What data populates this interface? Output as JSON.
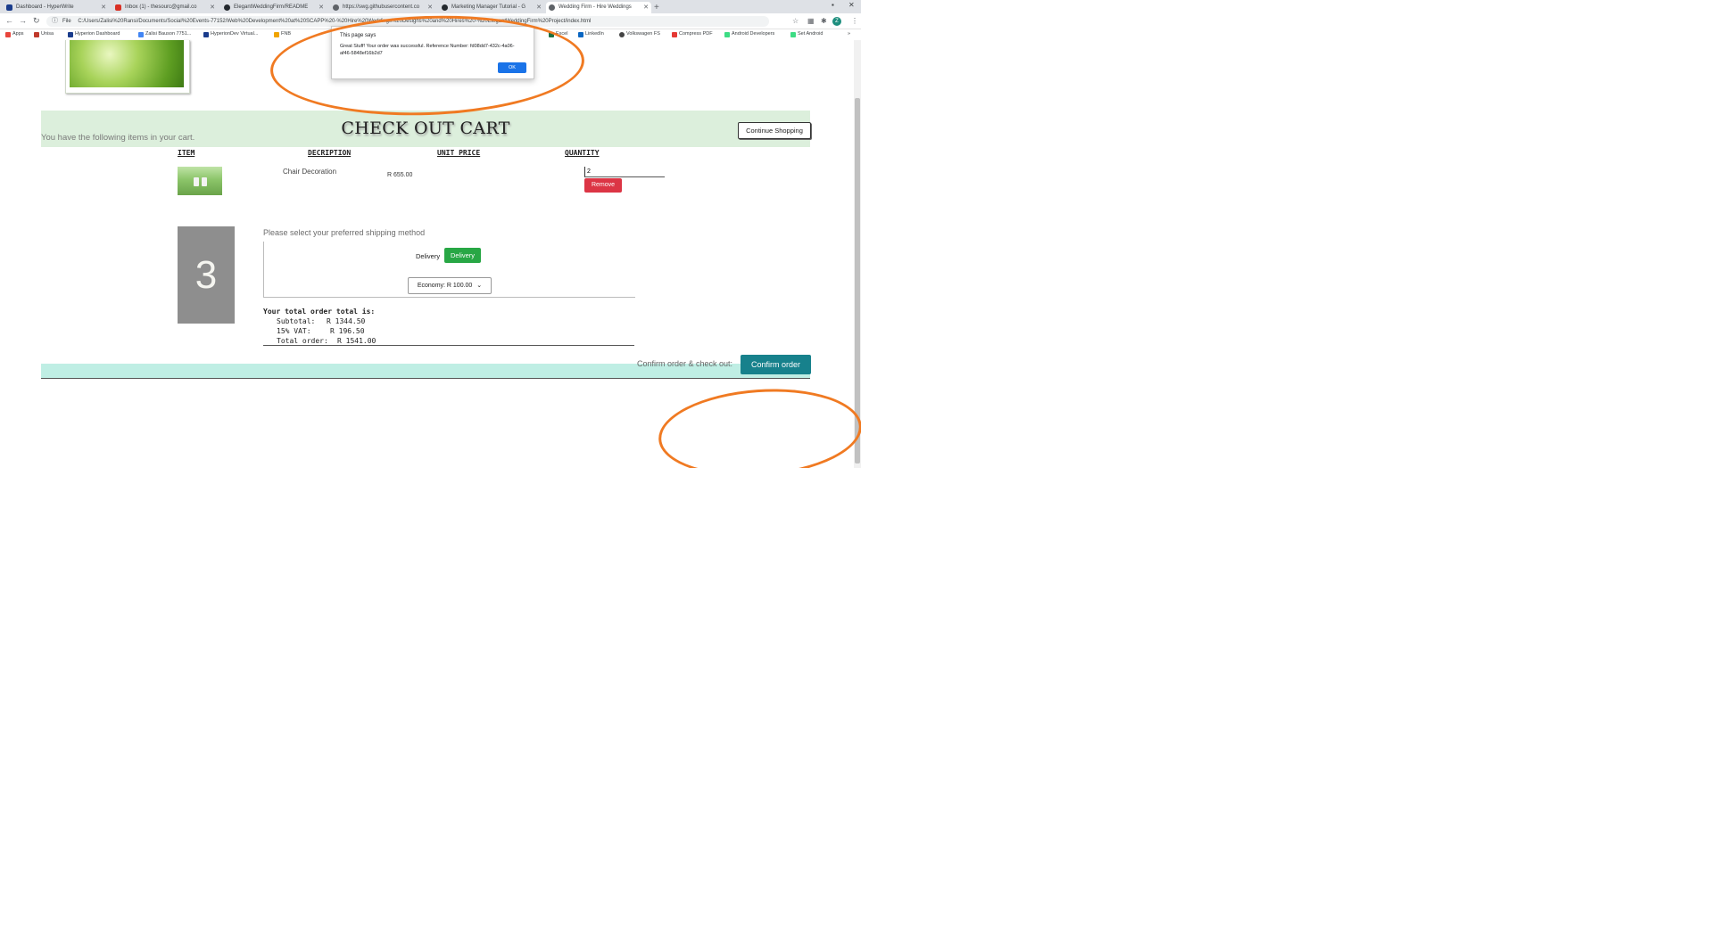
{
  "tabs": [
    {
      "title": "Dashboard - HyperWrite"
    },
    {
      "title": "Inbox (1) - thesourc@gmail.co"
    },
    {
      "title": "ElegantWeddingFirm/README"
    },
    {
      "title": "https://swg.githubusercontent.co"
    },
    {
      "title": "Marketing Manager Tutorial - G"
    },
    {
      "title": "Wedding Firm - Hire Weddings"
    }
  ],
  "address_bar": {
    "info_label": "File",
    "url": "C:/Users/Zalisi%20Ransi/Documents/Social%20Events-77152/Web%20Development%20at%20SCAPP%20-%20Hire%20Weddings%20Designs%20and%20Hires%20-%20ElegantWeddingFirm%20Project/index.html"
  },
  "bookmarks": [
    {
      "label": "Apps",
      "color": "#e8453c"
    },
    {
      "label": "Unisa",
      "color": "#c0392b"
    },
    {
      "label": "Hyperion Dashboard",
      "color": "#1a3c8c"
    },
    {
      "label": "Zalisi Bauson 7751...",
      "color": "#4285f4"
    },
    {
      "label": "HyperionDev Virtual...",
      "color": "#1a3c8c"
    },
    {
      "label": "FNB",
      "color": "#f0a400"
    },
    {
      "label": "Excel",
      "color": "#1d6f42"
    },
    {
      "label": "LinkedIn",
      "color": "#0a66c2"
    },
    {
      "label": "Volkswagen FS",
      "color": "#444444"
    },
    {
      "label": "Compress PDF",
      "color": "#e53935"
    },
    {
      "label": "Android Developers",
      "color": "#3ddc84"
    },
    {
      "label": "Set Android",
      "color": "#3ddc84"
    }
  ],
  "alert": {
    "title": "This page says",
    "message": "Great Stuff! Your order was successful. Reference Number: fd08dd7-432c-4a06-af46-5848ef16b2d7",
    "ok_label": "OK"
  },
  "page": {
    "title": "CHECK OUT CART",
    "continue_label": "Continue Shopping",
    "intro": "You have the following items in your cart.",
    "columns": [
      "ITEM",
      "DECRIPTION",
      "UNIT PRICE",
      "QUANTITY"
    ],
    "cart_items": [
      {
        "description": "Chair Decoration",
        "unit_price": "R 655.00",
        "quantity": "2",
        "remove_label": "Remove"
      }
    ],
    "step_number": "3",
    "shipping_prompt": "Please select your preferred shipping method",
    "delivery_label": "Delivery",
    "delivery_button": "Delivery",
    "shipping_option": "Economy: R 100.00",
    "totals_heading": "Your total order total is:",
    "totals": [
      {
        "label": "Subtotal:",
        "value": "R 1344.50"
      },
      {
        "label": "15% VAT:",
        "value": "R 196.50"
      },
      {
        "label": "Total order:",
        "value": "R 1541.00"
      }
    ],
    "confirm_text": "Confirm order & check out:",
    "confirm_button": "Confirm order"
  },
  "colors": {
    "annotation": "#f07a22",
    "title_band": "#dcefdc",
    "footer_band": "#bfeee4",
    "confirm": "#17818c",
    "remove": "#dc3545",
    "delivery": "#28a745"
  },
  "icons": [
    "back-icon",
    "forward-icon",
    "reload-icon",
    "info-icon",
    "star-icon",
    "extensions-icon",
    "menu-icon",
    "minimize-icon",
    "close-icon",
    "new-tab-icon"
  ]
}
